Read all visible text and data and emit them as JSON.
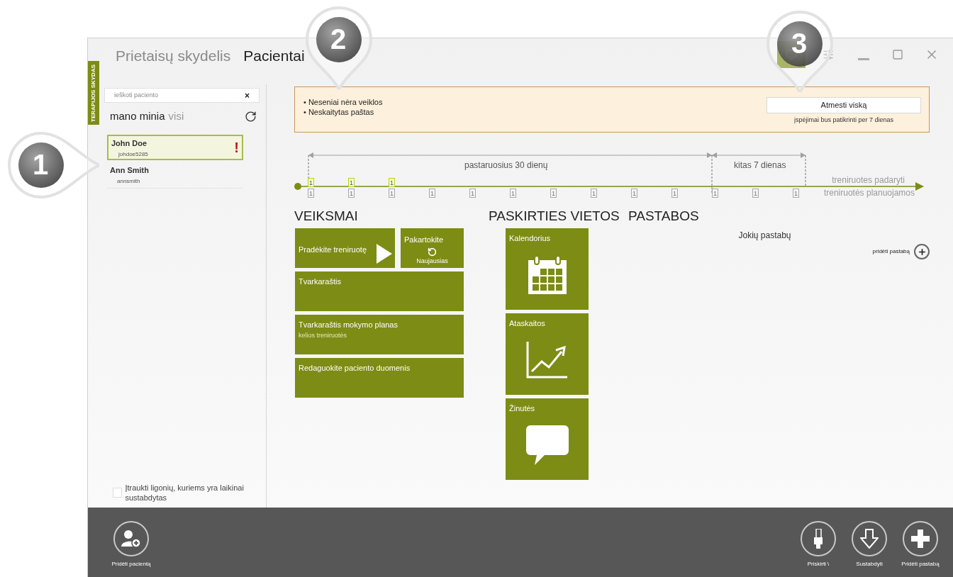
{
  "side_tab": "TERAPIJOS SKYDAS",
  "nav": [
    {
      "label": "Prietaisų skydelis",
      "selected": false
    },
    {
      "label": "Pacientai",
      "selected": true
    }
  ],
  "toolbar": [
    {
      "kind": "monitors",
      "selected": true
    },
    {
      "kind": "sliders",
      "selected": false
    }
  ],
  "search": {
    "placeholder": "ieškoti paciento",
    "clear": "×"
  },
  "filters": [
    {
      "label": "mano minia",
      "selected": true
    },
    {
      "label": "visi",
      "selected": false
    }
  ],
  "patients": [
    {
      "name": "John Doe",
      "username": "johdoe5285",
      "selected": true,
      "alert_mark": "!"
    },
    {
      "name": "Ann Smith",
      "username": "annsmith",
      "selected": false
    }
  ],
  "include_suspended": {
    "label": "Įtraukti ligonių, kuriems yra laikinai sustabdytas",
    "checked": false
  },
  "alerts": {
    "items": [
      "• Neseniai nėra veiklos",
      "• Neskaitytas paštas"
    ],
    "dismiss_button": "Atmesti viską",
    "note": "įspėjimai bus patikrinti per 7 dienas"
  },
  "timeline": {
    "past_label": "pastaruosius 30 dienų",
    "next_label": "kitas 7 dienas",
    "done_label": "treniruotes padaryti",
    "planned_label": "treniruotės planuojamos",
    "days": [
      {
        "done": "1",
        "planned": "1"
      },
      {
        "done": "1",
        "planned": "1"
      },
      {
        "done": "1",
        "planned": "1"
      },
      {
        "planned": "1"
      },
      {
        "planned": "1"
      },
      {
        "planned": "1"
      },
      {
        "planned": "1"
      },
      {
        "planned": "1"
      },
      {
        "planned": "1"
      },
      {
        "planned": "1"
      },
      {
        "planned": "1"
      },
      {
        "planned": "1"
      },
      {
        "planned": "1"
      }
    ]
  },
  "actions": {
    "title": "VEIKSMAI",
    "tiles": [
      {
        "kind": "start",
        "label": "Pradėkite treniruotę"
      },
      {
        "kind": "repeat",
        "label": "Pakartokite",
        "sublabel": "Naujausias"
      },
      {
        "kind": "wide",
        "label": "Tvarkaraštis"
      },
      {
        "kind": "wide",
        "label": "Tvarkaraštis mokymo planas",
        "sublabel": "kelios treniruotės"
      },
      {
        "kind": "wide",
        "label": "Redaguokite paciento duomenis"
      }
    ]
  },
  "destinations": {
    "title": "PASKIRTIES VIETOS",
    "tiles": [
      {
        "kind": "calendar",
        "label": "Kalendorius"
      },
      {
        "kind": "reports",
        "label": "Ataskaitos"
      },
      {
        "kind": "messages",
        "label": "Žinutės"
      }
    ]
  },
  "notes": {
    "title": "PASTABOS",
    "empty_text": "Jokių pastabų",
    "add_label": "pridėti pastabą"
  },
  "app_bar": {
    "left": [
      {
        "kind": "add-patient",
        "label": "Pridėti pacientą"
      }
    ],
    "right": [
      {
        "kind": "assign",
        "label": "Priskirti \\"
      },
      {
        "kind": "suspend",
        "label": "Sustabdyti"
      },
      {
        "kind": "add-note",
        "label": "Pridėti pastabą"
      }
    ]
  },
  "callouts": [
    {
      "label": "1"
    },
    {
      "label": "2"
    },
    {
      "label": "3"
    }
  ]
}
